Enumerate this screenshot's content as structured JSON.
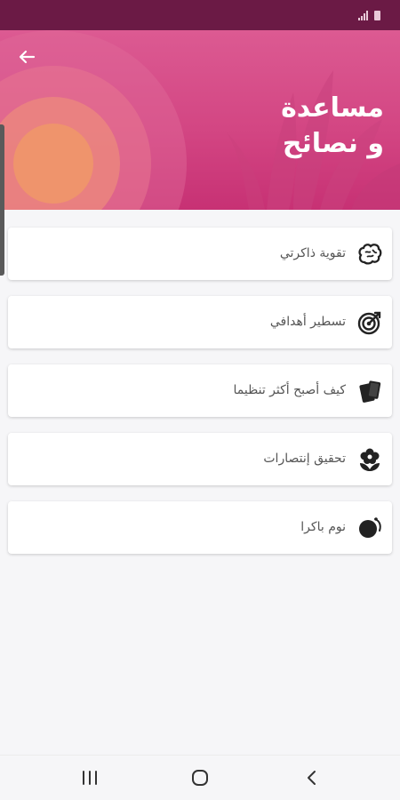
{
  "status_bar": {
    "icons": [
      "signal-icon",
      "battery-icon"
    ]
  },
  "header": {
    "title": "مساعدة\nو نصائح",
    "back_icon": "arrow-left-icon"
  },
  "items": [
    {
      "label": "تقوية ذاكرتي",
      "icon": "brain-icon"
    },
    {
      "label": "تسطير أهدافي",
      "icon": "target-icon"
    },
    {
      "label": "كيف أصبح أكثر تنظيما",
      "icon": "cards-icon"
    },
    {
      "label": "تحقيق إنتصارات",
      "icon": "flower-icon"
    },
    {
      "label": "نوم باكرا",
      "icon": "moon-sleep-icon"
    }
  ],
  "nav_bar": {
    "icons": [
      "recents-icon",
      "home-icon",
      "back-chevron-icon"
    ]
  },
  "colors": {
    "accent": "#d34683",
    "status_bar": "#6b1a45",
    "background": "#f6f6f8"
  }
}
